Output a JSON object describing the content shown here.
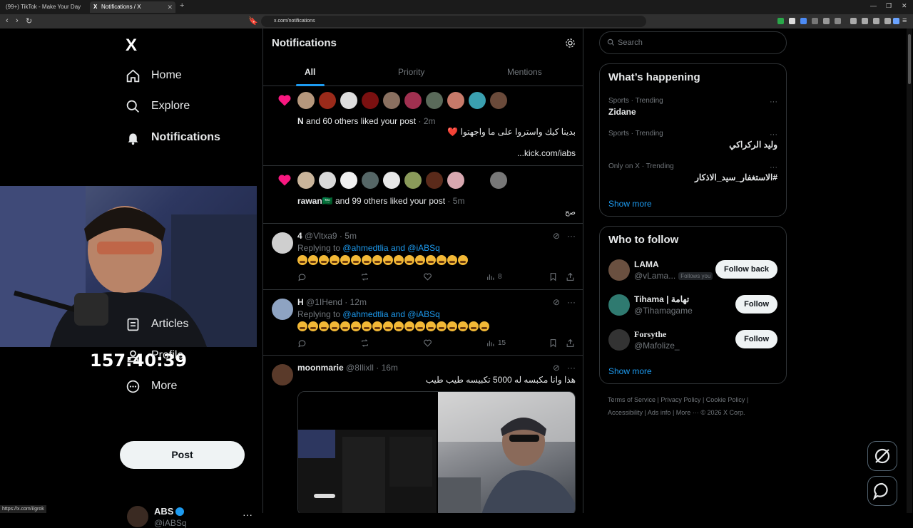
{
  "browser": {
    "tabs": [
      {
        "title": "(99+) TikTok - Make Your Day"
      },
      {
        "title": "Notifications / X"
      }
    ],
    "url": "x.com/notifications",
    "status_url": "https://x.com/i/grok"
  },
  "sidebar": {
    "logo": "X",
    "items": [
      {
        "label": "Home",
        "icon": "home-icon"
      },
      {
        "label": "Explore",
        "icon": "search-icon"
      },
      {
        "label": "Notifications",
        "icon": "bell-icon"
      },
      {
        "label": "Articles",
        "icon": "article-icon"
      },
      {
        "label": "Profile",
        "icon": "person-icon"
      },
      {
        "label": "More",
        "icon": "more-circle-icon"
      }
    ],
    "post_label": "Post",
    "account": {
      "name": "ABS",
      "handle": "@iABSq"
    }
  },
  "overlay": {
    "timer": "157:40:39"
  },
  "main": {
    "title": "Notifications",
    "tabs": [
      "All",
      "Priority",
      "Mentions"
    ],
    "notifications": [
      {
        "actor": "N",
        "text": "and 60 others liked your post",
        "time": "2m",
        "post_text": "بدينا كيك واستروا على ما واجهتوا ❤️",
        "post_link": "kick.com/iabs..."
      },
      {
        "actor": "rawan🇸🇦",
        "text": "and 99 others liked your post",
        "time": "5m",
        "post_text": "صح"
      }
    ],
    "tweets": [
      {
        "name": "4",
        "handle": "@Vltxa9",
        "time": "5m",
        "replying_prefix": "Replying to",
        "replying_to": "@ahmedtlia and @iABSq",
        "emoji_count": 16,
        "views": "8"
      },
      {
        "name": "H",
        "handle": "@1IHend",
        "time": "12m",
        "replying_prefix": "Replying to",
        "replying_to": "@ahmedtlia and @iABSq",
        "emoji_count": 18,
        "views": "15"
      },
      {
        "name": "moonmarie",
        "handle": "@8Ilixll",
        "time": "16m",
        "text": "هذا وانا مكبسه له 5000 تكبيسه طيب طيب"
      }
    ]
  },
  "right": {
    "search_placeholder": "Search",
    "happening_title": "What’s happening",
    "trends": [
      {
        "meta": "Sports · Trending",
        "name": "Zidane"
      },
      {
        "meta": "Sports · Trending",
        "name": "وليد الركراكي"
      },
      {
        "meta": "Only on X · Trending",
        "name": "#الاستغفار_سيد_الاذكار"
      }
    ],
    "show_more": "Show more",
    "who_title": "Who to follow",
    "follows": [
      {
        "name": "LAMA",
        "handle": "@vLama...",
        "badge": "Follows you",
        "button": "Follow back"
      },
      {
        "name": "Tihama | تهامة",
        "handle": "@Tihamagame",
        "button": "Follow"
      },
      {
        "name": "Forsythe",
        "handle": "@Mafolize_",
        "button": "Follow"
      }
    ],
    "footer_row1": [
      "Terms of Service",
      "Privacy Policy",
      "Cookie Policy"
    ],
    "footer_row2": [
      "Accessibility",
      "Ads info",
      "More ···",
      "© 2026 X Corp."
    ]
  }
}
